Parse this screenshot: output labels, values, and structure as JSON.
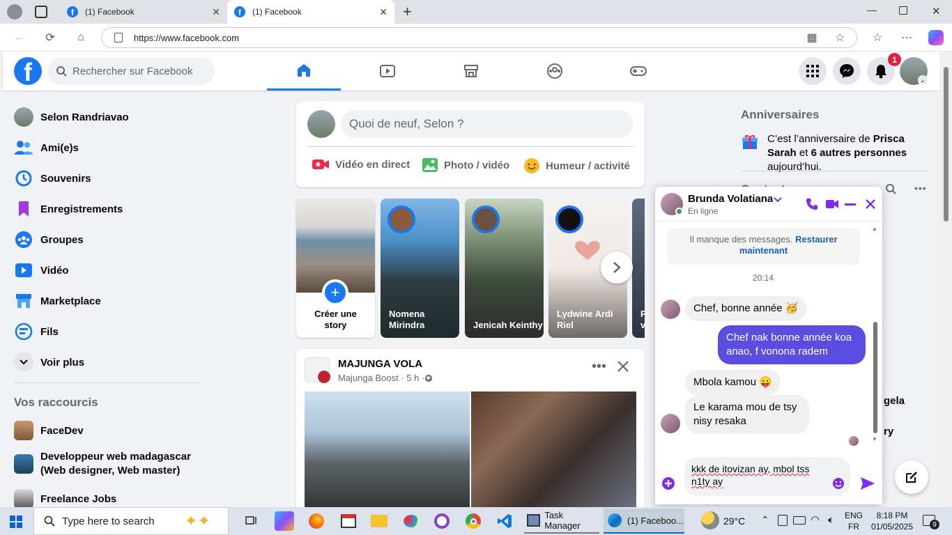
{
  "browser": {
    "tabs": [
      {
        "title": "(1) Facebook",
        "active": false
      },
      {
        "title": "(1) Facebook",
        "active": true
      }
    ],
    "url": "https://www.facebook.com"
  },
  "header": {
    "search_placeholder": "Rechercher sur Facebook",
    "notification_count": "1"
  },
  "sidebar": {
    "items": [
      {
        "label": "Selon Randriavao",
        "icon": "profile-avatar"
      },
      {
        "label": "Ami(e)s",
        "icon": "friends-icon"
      },
      {
        "label": "Souvenirs",
        "icon": "memories-icon"
      },
      {
        "label": "Enregistrements",
        "icon": "bookmark-icon"
      },
      {
        "label": "Groupes",
        "icon": "groups-icon"
      },
      {
        "label": "Vidéo",
        "icon": "video-icon"
      },
      {
        "label": "Marketplace",
        "icon": "marketplace-icon"
      },
      {
        "label": "Fils",
        "icon": "feeds-icon"
      },
      {
        "label": "Voir plus",
        "icon": "chevron-down-icon"
      }
    ],
    "shortcuts_title": "Vos raccourcis",
    "shortcuts": [
      {
        "label": "FaceDev"
      },
      {
        "label": "Developpeur web madagascar (Web designer, Web master)"
      },
      {
        "label": "Freelance Jobs"
      }
    ]
  },
  "composer": {
    "placeholder": "Quoi de neuf, Selon ?",
    "actions": [
      {
        "label": "Vidéo en direct",
        "color": "#f02849"
      },
      {
        "label": "Photo / vidéo",
        "color": "#45bd62"
      },
      {
        "label": "Humeur / activité",
        "color": "#f7b928"
      }
    ]
  },
  "stories": [
    {
      "label": "Créer une story"
    },
    {
      "label": "Nomena Mirindra"
    },
    {
      "label": "Jenicah Keinthy"
    },
    {
      "label": "Lydwine Ardi Riel"
    },
    {
      "label": "P v"
    }
  ],
  "post": {
    "page_name": "MAJUNGA VOLA",
    "meta": "Majunga Boost · 5 h · "
  },
  "right": {
    "birthdays_title": "Anniversaires",
    "birthday_pre": "C’est l’anniversaire de ",
    "birthday_name": "Prisca Sarah",
    "birthday_mid": " et ",
    "birthday_others": "6 autres personnes",
    "birthday_post": " aujourd’hui.",
    "contacts_title": "Contacts",
    "partial1": "gela",
    "partial2": "ry"
  },
  "chat": {
    "name": "Brunda Volatiana",
    "status": "En ligne",
    "missing_text": "Il manque des messages. ",
    "restore_link": "Restaurer maintenant",
    "time": "20:14",
    "messages": [
      {
        "from": "in",
        "text": "Chef, bonne année 🥳"
      },
      {
        "from": "out",
        "text": "Chef nak bonne année koa anao, f vonona radem"
      },
      {
        "from": "in",
        "text": "Mbola kamou 😛"
      },
      {
        "from": "in",
        "text": "Le karama mou de tsy nisy resaka"
      }
    ],
    "draft": "kkk de itovizan ay, mbol tss n1ty ay"
  },
  "taskbar": {
    "search_placeholder": "Type here to search",
    "apps": [
      {
        "label": "Task Manager"
      },
      {
        "label": "(1) Faceboo..."
      }
    ],
    "weather": "29°C",
    "lang1": "ENG",
    "lang2": "FR",
    "time": "8:18 PM",
    "date": "01/05/2025",
    "notif": "9"
  }
}
